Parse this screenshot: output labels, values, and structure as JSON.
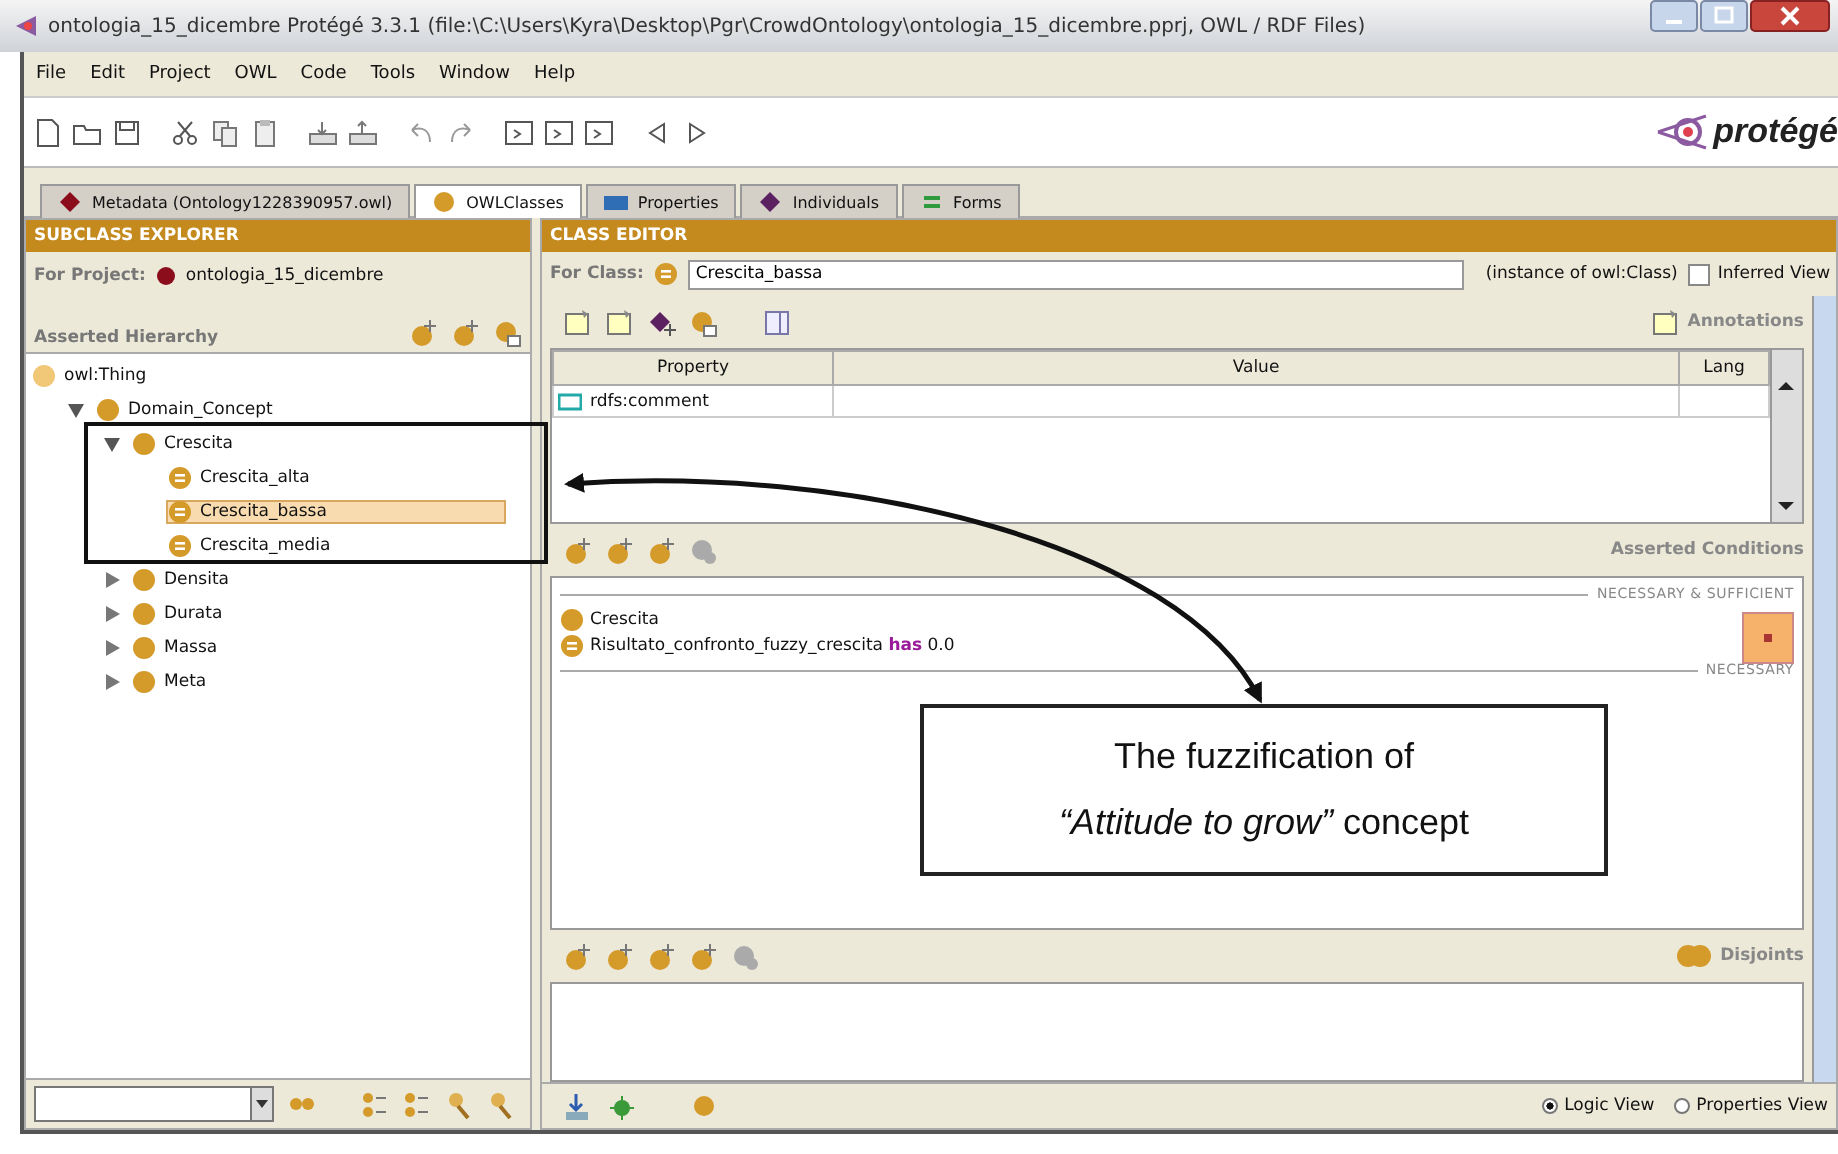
{
  "window": {
    "title": "ontologia_15_dicembre  Protégé 3.3.1     (file:\\C:\\Users\\Kyra\\Desktop\\Pgr\\CrowdOntology\\ontologia_15_dicembre.pprj, OWL / RDF Files)"
  },
  "menu": [
    "File",
    "Edit",
    "Project",
    "OWL",
    "Code",
    "Tools",
    "Window",
    "Help"
  ],
  "logo": "protégé",
  "tabs": [
    {
      "label": "Metadata (Ontology1228390957.owl)",
      "selected": false,
      "kind": "diamond",
      "color": "#8b0d1c"
    },
    {
      "label": "OWLClasses",
      "selected": true,
      "kind": "circle",
      "color": "#d49a2a"
    },
    {
      "label": "Properties",
      "selected": false,
      "kind": "bar",
      "color": "#2f6db4"
    },
    {
      "label": "Individuals",
      "selected": false,
      "kind": "diamond",
      "color": "#5a2060"
    },
    {
      "label": "Forms",
      "selected": false,
      "kind": "lines",
      "color": "#2e9a3c"
    }
  ],
  "subclass_explorer": {
    "title": "SUBCLASS EXPLORER",
    "project_label": "For Project:",
    "project_name": "ontologia_15_dicembre",
    "hierarchy_label": "Asserted Hierarchy",
    "tree": [
      {
        "label": "owl:Thing",
        "kind": "root",
        "children": [
          {
            "label": "Domain_Concept",
            "kind": "class",
            "expanded": true,
            "selected": false,
            "children": [
              {
                "label": "Crescita",
                "kind": "class",
                "expanded": true,
                "selected": false,
                "children": [
                  {
                    "label": "Crescita_alta",
                    "kind": "defined",
                    "selected": false
                  },
                  {
                    "label": "Crescita_bassa",
                    "kind": "defined",
                    "selected": true
                  },
                  {
                    "label": "Crescita_media",
                    "kind": "defined",
                    "selected": false
                  }
                ]
              },
              {
                "label": "Densita",
                "kind": "class",
                "expanded": false,
                "selected": false
              },
              {
                "label": "Durata",
                "kind": "class",
                "expanded": false,
                "selected": false
              },
              {
                "label": "Massa",
                "kind": "class",
                "expanded": false,
                "selected": false
              },
              {
                "label": "Meta",
                "kind": "class",
                "expanded": false,
                "selected": false
              }
            ]
          }
        ]
      }
    ]
  },
  "class_editor": {
    "title": "CLASS EDITOR",
    "for_class_label": "For Class:",
    "class_name": "Crescita_bassa",
    "instance_of": "(instance of owl:Class)",
    "inferred_view": {
      "label": "Inferred View",
      "checked": false
    },
    "annotations_label": "Annotations",
    "columns": [
      "Property",
      "Value",
      "Lang"
    ],
    "rows": [
      {
        "property": "rdfs:comment"
      }
    ],
    "conditions_title": "Asserted Conditions",
    "condition_groups": [
      {
        "heading": "NECESSARY & SUFFICIENT",
        "items": [
          {
            "kind": "class",
            "text": "Crescita"
          },
          {
            "kind": "defined",
            "text": "Risultato_confronto_fuzzy_crescita **has** 0.0"
          }
        ]
      },
      {
        "heading": "NECESSARY"
      }
    ],
    "disjoints_title": "Disjoints",
    "views": [
      {
        "label": "Logic View",
        "selected": true
      },
      {
        "label": "Properties View",
        "selected": false
      }
    ]
  },
  "callout": {
    "lines": [
      "The fuzzification of",
      "*“Attitude to grow”* concept"
    ]
  }
}
